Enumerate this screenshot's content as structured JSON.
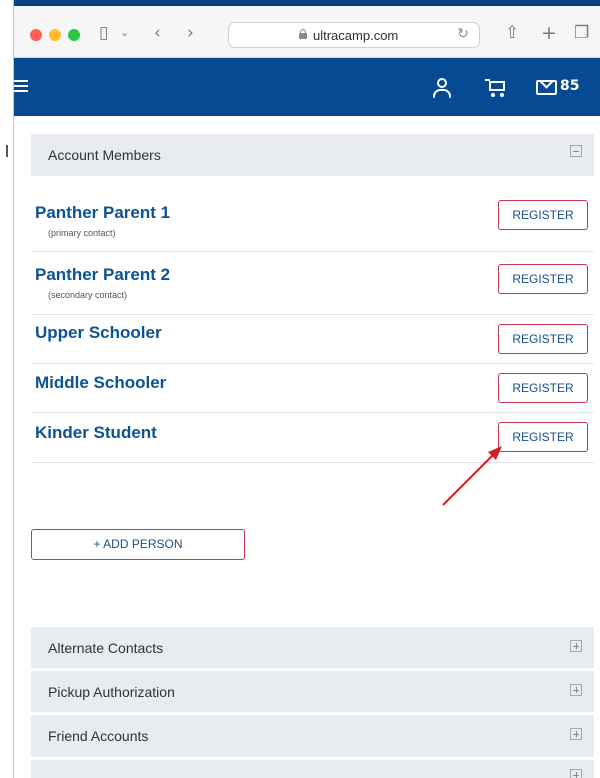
{
  "browser": {
    "url": "ultracamp.com"
  },
  "nav": {
    "mail_count": "85",
    "colors": {
      "bar": "#064a93"
    }
  },
  "account_members": {
    "title": "Account Members",
    "members": [
      {
        "name": "Panther Parent 1",
        "role": "(primary contact)",
        "button": "REGISTER"
      },
      {
        "name": "Panther Parent 2",
        "role": "(secondary contact)",
        "button": "REGISTER"
      },
      {
        "name": "Upper Schooler",
        "role": "",
        "button": "REGISTER"
      },
      {
        "name": "Middle Schooler",
        "role": "",
        "button": "REGISTER"
      },
      {
        "name": "Kinder Student",
        "role": "",
        "button": "REGISTER"
      }
    ],
    "add_button": "+ ADD PERSON"
  },
  "sections": [
    {
      "title": "Alternate Contacts"
    },
    {
      "title": "Pickup Authorization"
    },
    {
      "title": "Friend Accounts"
    }
  ],
  "colors": {
    "accent_border": "#c9334f",
    "name_blue": "#0b5394",
    "annotation_arrow": "#d11f2a"
  }
}
